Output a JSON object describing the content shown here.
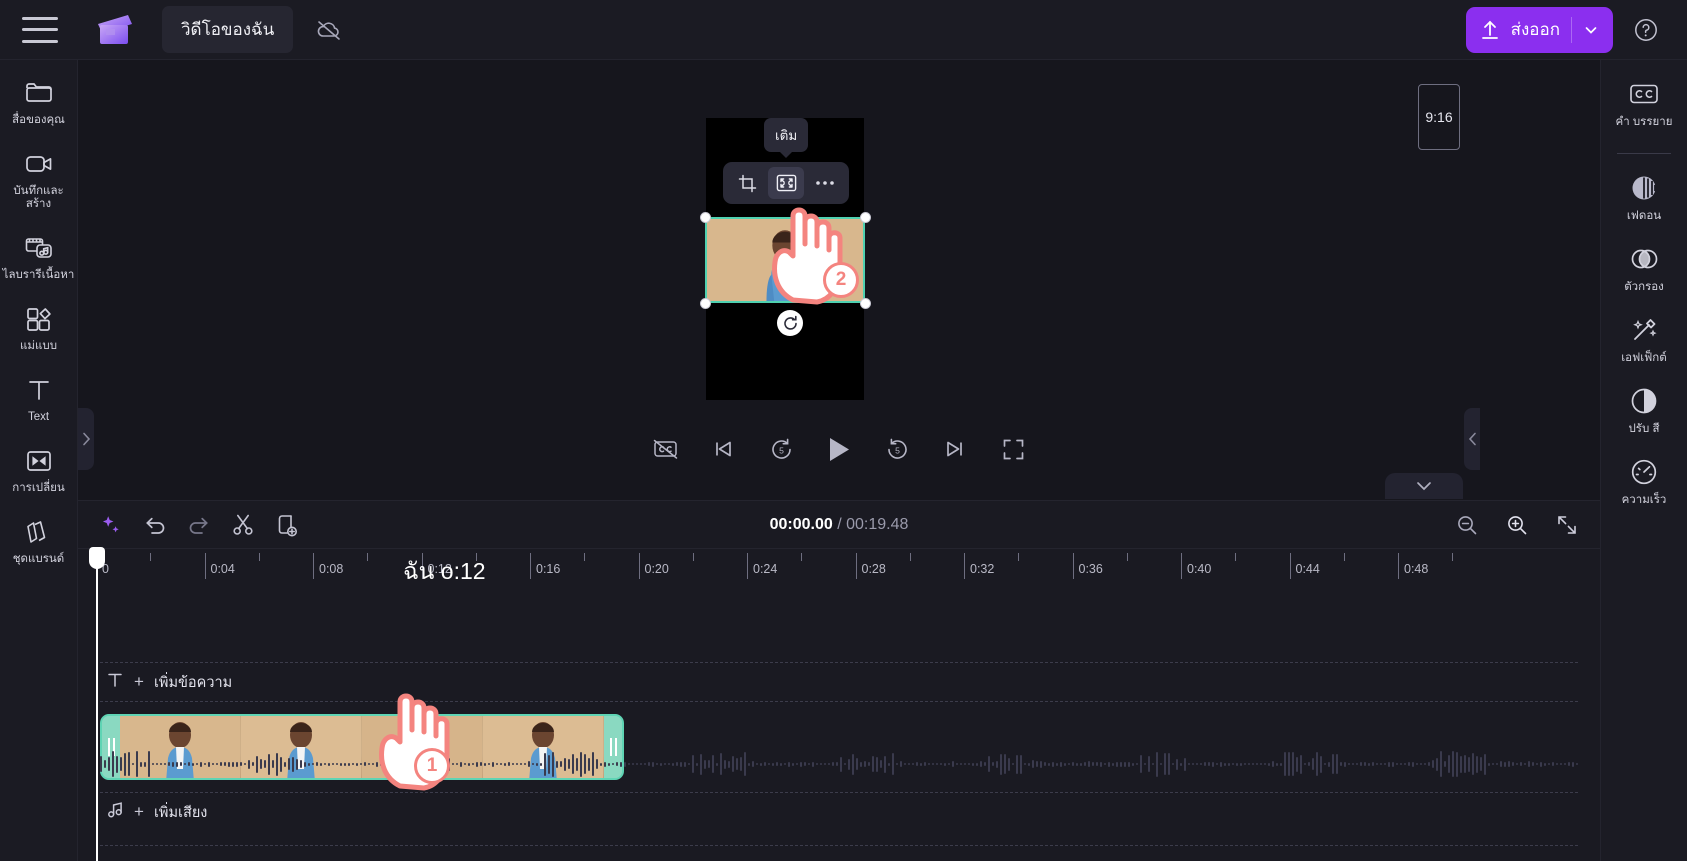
{
  "app": {
    "project_title": "วิดีโอของฉัน",
    "logo_name": "clipchamp-logo"
  },
  "topbar": {
    "menu_icon": "hamburger-menu-icon",
    "cloud_icon": "cloud-off-icon",
    "export_label": "ส่งออก",
    "export_color": "#8b2fef",
    "export_upload_icon": "upload-icon",
    "export_chevron_icon": "chevron-down-icon",
    "help_icon": "help-circle-icon"
  },
  "left_rail": {
    "items": [
      {
        "label": "สื่อของคุณ",
        "icon": "folder-icon"
      },
      {
        "label": "บันทึกและสร้าง",
        "icon": "video-camera-icon"
      },
      {
        "label": "ไลบรารีเนื้อหา",
        "icon": "content-library-icon"
      },
      {
        "label": "แม่แบบ",
        "icon": "templates-icon"
      },
      {
        "label": "Text",
        "icon": "text-icon"
      },
      {
        "label": "การเปลี่ยน",
        "icon": "transitions-icon"
      },
      {
        "label": "ชุดแบรนด์",
        "icon": "brand-kit-icon"
      }
    ]
  },
  "right_rail": {
    "items": [
      {
        "label": "คำ บรรยาย",
        "icon": "closed-caption-icon"
      },
      {
        "label": "เฟดอน",
        "icon": "fade-icon"
      },
      {
        "label": "ตัวกรอง",
        "icon": "filters-icon"
      },
      {
        "label": "เอฟเฟ็กต์",
        "icon": "effects-wand-icon"
      },
      {
        "label": "ปรับ สี",
        "icon": "adjust-color-icon"
      },
      {
        "label": "ความเร็ว",
        "icon": "speed-gauge-icon"
      }
    ]
  },
  "stage": {
    "aspect_ratio": "9:16",
    "tooltip_label": "เติม",
    "float_toolbar": [
      {
        "icon": "crop-icon",
        "active": false
      },
      {
        "icon": "fill-fit-icon",
        "active": true
      },
      {
        "icon": "more-horizontal-icon",
        "active": false
      }
    ],
    "rotate_icon": "rotate-icon",
    "selection_color": "#4fd1b0",
    "collapse_left_icon": "chevron-right-icon",
    "collapse_right_icon": "chevron-left-icon"
  },
  "playback": {
    "controls": [
      {
        "icon": "captions-off-icon",
        "name": "captions-toggle"
      },
      {
        "icon": "skip-start-icon",
        "name": "skip-to-start"
      },
      {
        "icon": "rewind-5-icon",
        "name": "rewind-5-seconds",
        "label": "5"
      },
      {
        "icon": "play-icon",
        "name": "play-button"
      },
      {
        "icon": "forward-5-icon",
        "name": "forward-5-seconds",
        "label": "5"
      },
      {
        "icon": "skip-end-icon",
        "name": "skip-to-end"
      },
      {
        "icon": "fullscreen-icon",
        "name": "fullscreen-button"
      }
    ]
  },
  "timeline": {
    "collapse_icon": "chevron-down-icon",
    "tools": [
      {
        "icon": "ai-sparkle-icon",
        "name": "ai-tools-button"
      },
      {
        "icon": "undo-icon",
        "name": "undo-button"
      },
      {
        "icon": "redo-icon",
        "name": "redo-button"
      },
      {
        "icon": "scissors-icon",
        "name": "split-button"
      },
      {
        "icon": "duplicate-icon",
        "name": "duplicate-button"
      }
    ],
    "current_time": "00:00.00",
    "total_time": "00:19.48",
    "time_separator": " / ",
    "zoom_controls": [
      {
        "icon": "zoom-out-icon",
        "name": "zoom-out-button"
      },
      {
        "icon": "zoom-in-icon",
        "name": "zoom-in-button"
      },
      {
        "icon": "fit-timeline-icon",
        "name": "fit-to-timeline-button"
      }
    ],
    "ruler": {
      "labels": [
        "0",
        "0:04",
        "0:08",
        "0:12",
        "0:16",
        "0:20",
        "0:24",
        "0:28",
        "0:32",
        "0:36",
        "0:40",
        "0:44",
        "0:48"
      ],
      "overlay_text": "ฉัน o:12"
    },
    "text_track": {
      "icon": "text-icon",
      "plus": "+",
      "label": "เพิ่มข้อความ"
    },
    "audio_track": {
      "icon": "music-note-icon",
      "plus": "+",
      "label": "เพิ่มเสียง"
    },
    "video_clip": {
      "name": "video-clip",
      "selected": true,
      "border_color": "#5fd4b4",
      "left_handle_icon": "trim-handle-left",
      "right_handle_icon": "trim-handle-right"
    }
  },
  "annotations": [
    {
      "number": "1",
      "name": "annotation-hand-1",
      "target": "video-clip-on-timeline"
    },
    {
      "number": "2",
      "name": "annotation-hand-2",
      "target": "fill-fit-button"
    }
  ]
}
